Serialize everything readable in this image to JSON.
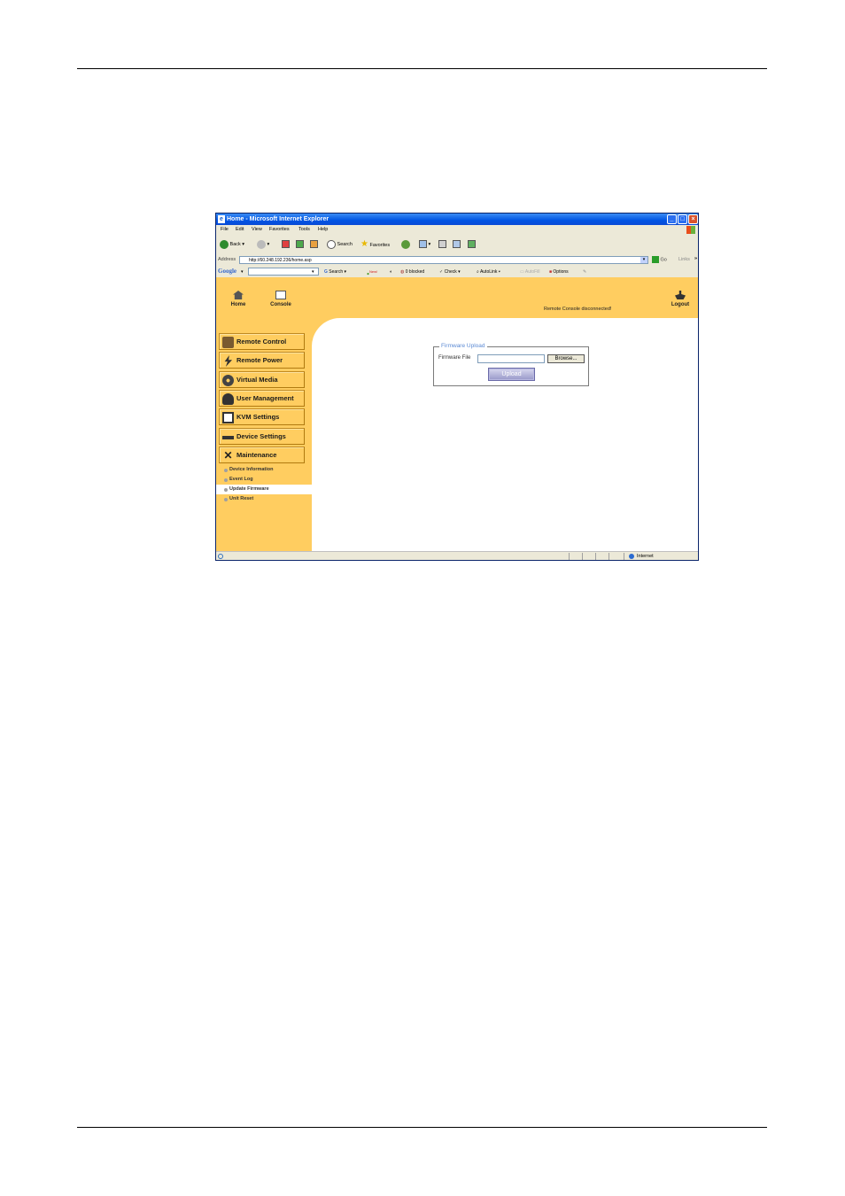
{
  "browser": {
    "title": "Home - Microsoft Internet Explorer",
    "menu": [
      "File",
      "Edit",
      "View",
      "Favorites",
      "Tools",
      "Help"
    ],
    "toolbar": {
      "back": "Back",
      "search": "Search",
      "favorites": "Favorites"
    },
    "address_label": "Address",
    "address": "http://60.248.192.236/home.asp",
    "go": "Go",
    "links": "Links",
    "google": {
      "logo": "Google",
      "search": "Search",
      "new_badge": "New!",
      "blocked": "0 blocked",
      "check": "Check",
      "autolink": "AutoLink",
      "autofill": "AutoFill",
      "options": "Options"
    },
    "status_zone": "Internet"
  },
  "page": {
    "nav": {
      "home": "Home",
      "console": "Console",
      "logout": "Logout"
    },
    "status_message": "Remote Console disconnected!",
    "sidebar": [
      {
        "label": "Remote Control",
        "icon": "remote-control-icon"
      },
      {
        "label": "Remote Power",
        "icon": "lightning-icon"
      },
      {
        "label": "Virtual Media",
        "icon": "disc-icon"
      },
      {
        "label": "User Management",
        "icon": "users-icon"
      },
      {
        "label": "KVM Settings",
        "icon": "monitor-icon"
      },
      {
        "label": "Device Settings",
        "icon": "device-icon"
      },
      {
        "label": "Maintenance",
        "icon": "tools-icon"
      }
    ],
    "submenu": [
      {
        "label": "Device Information",
        "active": false
      },
      {
        "label": "Event Log",
        "active": false
      },
      {
        "label": "Update Firmware",
        "active": true
      },
      {
        "label": "Unit Reset",
        "active": false
      }
    ],
    "firmware": {
      "legend": "Firmware Upload",
      "field_label": "Firmware File",
      "field_value": "",
      "browse": "Browse...",
      "upload": "Upload"
    }
  },
  "colors": {
    "page_bg": "#ffcd60",
    "title_bar": "#0054e3",
    "legend": "#5b8ad4"
  }
}
